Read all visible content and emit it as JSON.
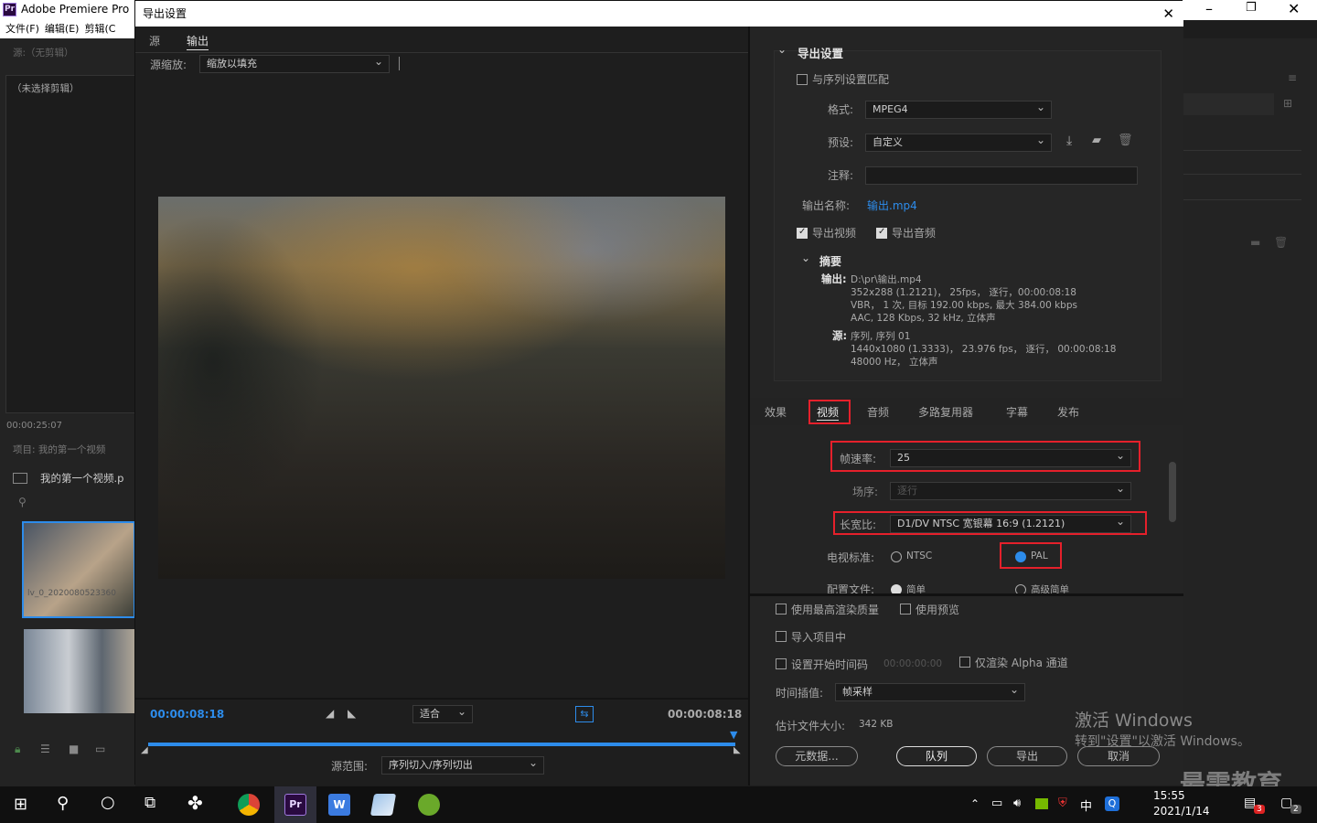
{
  "app": {
    "title": "Adobe Premiere Pro",
    "menu": [
      "文件(F)",
      "编辑(E)",
      "剪辑(C"
    ]
  },
  "left_panel": {
    "source_label": "源:（无剪辑）",
    "no_clip": "（未选择剪辑）",
    "timecode": "00:00:25:07",
    "project_title": "项目: 我的第一个视频",
    "project_item": "我的第一个视频.p",
    "clip_name": "lv_0_2020080523360"
  },
  "dialog": {
    "title": "导出设置",
    "tabs": [
      "源",
      "输出"
    ],
    "source_scale_label": "源缩放:",
    "source_scale_value": "缩放以填充",
    "timecode_in": "00:00:08:18",
    "timecode_out": "00:00:08:18",
    "fit_value": "适合",
    "source_range_label": "源范围:",
    "source_range_value": "序列切入/序列切出",
    "export_settings": {
      "header": "导出设置",
      "match_sequence": "与序列设置匹配",
      "format_label": "格式:",
      "format_value": "MPEG4",
      "preset_label": "预设:",
      "preset_value": "自定义",
      "comment_label": "注释:",
      "output_name_label": "输出名称:",
      "output_name_value": "输出.mp4",
      "export_video": "导出视频",
      "export_audio": "导出音频",
      "summary_header": "摘要",
      "summary_output_label": "输出:",
      "summary_output_lines": [
        "D:\\pr\\输出.mp4",
        "352x288 (1.2121)， 25fps， 逐行，00:00:08:18",
        "VBR， 1 次, 目标 192.00 kbps, 最大 384.00 kbps",
        "AAC, 128 Kbps, 32  kHz, 立体声"
      ],
      "summary_source_label": "源:",
      "summary_source_lines": [
        "序列, 序列 01",
        "1440x1080 (1.3333)， 23.976  fps， 逐行， 00:00:08:18",
        "48000 Hz， 立体声"
      ]
    },
    "settings_tabs": [
      "效果",
      "视频",
      "音频",
      "多路复用器",
      "字幕",
      "发布"
    ],
    "video": {
      "frame_rate_label": "帧速率:",
      "frame_rate_value": "25",
      "field_order_label": "场序:",
      "field_order_value": "逐行",
      "aspect_label": "长宽比:",
      "aspect_value": "D1/DV NTSC 宽银幕 16:9 (1.2121)",
      "tv_standard_label": "电视标准:",
      "ntsc": "NTSC",
      "pal": "PAL",
      "profile_label": "配置文件:",
      "profile_simple": "简单",
      "profile_advanced": "高级简单"
    },
    "bottom": {
      "max_quality": "使用最高渲染质量",
      "use_previews": "使用预览",
      "import_project": "导入项目中",
      "set_start_tc": "设置开始时间码",
      "start_tc_value": "00:00:00:00",
      "alpha_only": "仅渲染 Alpha 通道",
      "interp_label": "时间插值:",
      "interp_value": "帧采样",
      "file_size_label": "估计文件大小:",
      "file_size_value": "342 KB",
      "metadata_btn": "元数据...",
      "queue_btn": "队列",
      "export_btn": "导出",
      "cancel_btn": "取消"
    }
  },
  "watermark": {
    "line1": "激活 Windows",
    "line2": "转到\"设置\"以激活 Windows。",
    "brand": "最需教育"
  },
  "taskbar": {
    "time": "15:55",
    "date": "2021/1/14",
    "ime": "中",
    "badge1": "3",
    "badge2": "2"
  }
}
